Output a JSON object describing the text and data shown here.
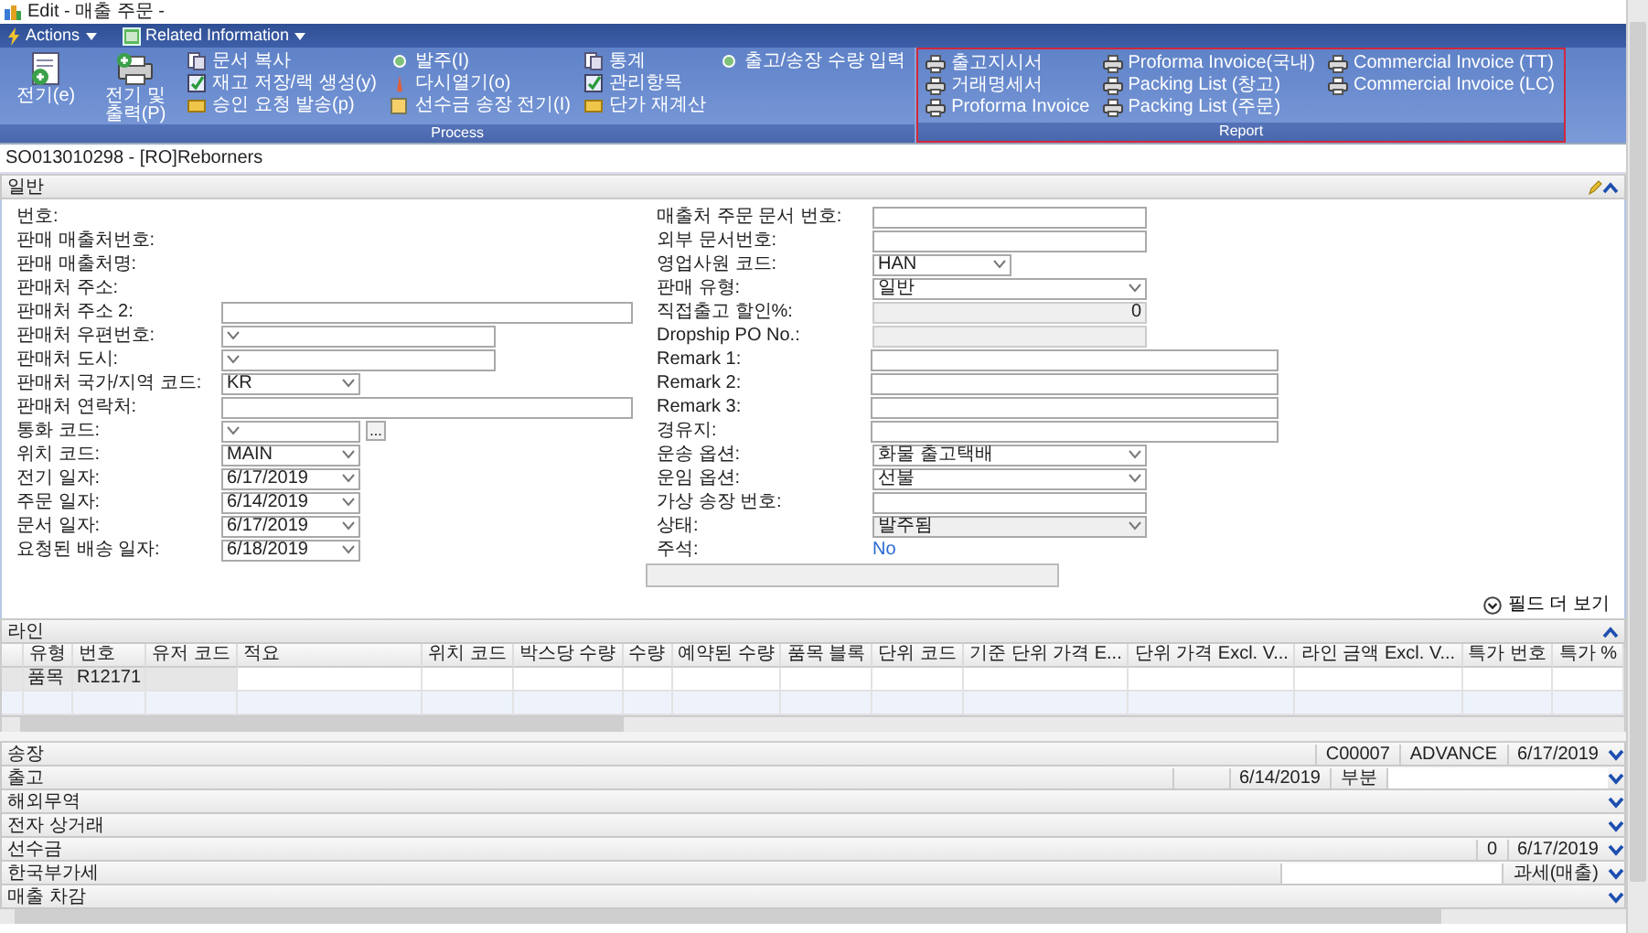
{
  "window": {
    "title": "Edit - 매출 주문 -"
  },
  "menu": [
    {
      "label": "Actions"
    },
    {
      "label": "Related Information"
    }
  ],
  "ribbon": {
    "groups": [
      {
        "label": "Process",
        "highlighted": false,
        "large_buttons": [
          {
            "label": "전기(e)"
          },
          {
            "label": "전기 및 출력(P)"
          }
        ],
        "columns": [
          [
            "문서 복사",
            "재고 저장/랙 생성(y)",
            "승인 요청 발송(p)"
          ],
          [
            "발주(I)",
            "다시열기(o)",
            "선수금 송장 전기(I)"
          ],
          [
            "통계",
            "관리항목",
            "단가 재계산"
          ],
          [
            "출고/송장 수량 입력"
          ]
        ]
      },
      {
        "label": "Report",
        "highlighted": true,
        "columns": [
          [
            "출고지시서",
            "거래명세서",
            "Proforma Invoice"
          ],
          [
            "Proforma Invoice(국내)",
            "Packing List (창고)",
            "Packing List (주문)"
          ],
          [
            "Commercial Invoice (TT)",
            "Commercial Invoice (LC)"
          ]
        ]
      }
    ]
  },
  "document_title": "SO013010298 - [RO]Reborners",
  "general": {
    "title": "일반",
    "expanded": true,
    "left_fields": [
      {
        "label": "번호:",
        "kind": "none"
      },
      {
        "label": "판매 매출처번호:",
        "kind": "none"
      },
      {
        "label": "판매 매출처명:",
        "kind": "none"
      },
      {
        "label": "판매처 주소:",
        "kind": "none"
      },
      {
        "label": "판매처 주소 2:",
        "kind": "text_wide"
      },
      {
        "label": "판매처 우편번호:",
        "kind": "select"
      },
      {
        "label": "판매처 도시:",
        "kind": "select"
      },
      {
        "label": "판매처 국가/지역 코드:",
        "kind": "select_short",
        "value": "KR"
      },
      {
        "label": "판매처 연락처:",
        "kind": "text_wide"
      },
      {
        "label": "통화 코드:",
        "kind": "lookup",
        "button": "..."
      },
      {
        "label": "위치 코드:",
        "kind": "select_short",
        "value": "MAIN"
      },
      {
        "label": "전기 일자:",
        "kind": "select_short",
        "value": "6/17/2019"
      },
      {
        "label": "주문 일자:",
        "kind": "select_short",
        "value": "6/14/2019"
      },
      {
        "label": "문서 일자:",
        "kind": "select_short",
        "value": "6/17/2019"
      },
      {
        "label": "요청된 배송 일자:",
        "kind": "select_short",
        "value": "6/18/2019"
      }
    ],
    "right_fields": [
      {
        "label": "매출처 주문 문서 번호:",
        "kind": "text"
      },
      {
        "label": "외부 문서번호:",
        "kind": "text"
      },
      {
        "label": "영업사원 코드:",
        "kind": "select_short",
        "value": "HAN"
      },
      {
        "label": "판매 유형:",
        "kind": "select",
        "value": "일반"
      },
      {
        "label": "직접출고 할인%:",
        "kind": "readonly",
        "value": "0"
      },
      {
        "label": "Dropship PO No.:",
        "kind": "readonly"
      },
      {
        "label": "Remark 1:",
        "kind": "text_wide"
      },
      {
        "label": "Remark 2:",
        "kind": "text_wide"
      },
      {
        "label": "Remark 3:",
        "kind": "text_wide"
      },
      {
        "label": "경유지:",
        "kind": "text_wide"
      },
      {
        "label": "운송 옵션:",
        "kind": "select",
        "value": "화물 출고택배"
      },
      {
        "label": "운임 옵션:",
        "kind": "select",
        "value": "선불"
      },
      {
        "label": "가상 송장 번호:",
        "kind": "text"
      },
      {
        "label": "상태:",
        "kind": "select_readonly",
        "value": "발주됨"
      },
      {
        "label": "주석:",
        "kind": "link",
        "value": "No"
      }
    ],
    "note_box": true,
    "more_fields": "필드 더 보기"
  },
  "lines": {
    "title": "라인",
    "expanded": true,
    "columns": [
      "유형",
      "번호",
      "유저 코드",
      "적요",
      "위치 코드",
      "박스당 수량",
      "수량",
      "예약된 수량",
      "품목 블록",
      "단위 코드",
      "기준 단위 가격 E...",
      "단위 가격 Excl. V...",
      "라인 금액 Excl. V...",
      "특가 번호",
      "특가 %"
    ],
    "rows": [
      {
        "cells": [
          "품목",
          "R12171"
        ],
        "selected": true
      }
    ]
  },
  "sections": [
    {
      "title": "송장",
      "values": [
        {
          "kind": "text",
          "text": "C00007"
        },
        {
          "kind": "text",
          "text": "ADVANCE"
        },
        {
          "kind": "text",
          "text": "6/17/2019"
        }
      ]
    },
    {
      "title": "출고",
      "values": [
        {
          "kind": "empty"
        },
        {
          "kind": "text",
          "text": "6/14/2019"
        },
        {
          "kind": "text",
          "text": "부분"
        },
        {
          "kind": "box"
        }
      ]
    },
    {
      "title": "해외무역"
    },
    {
      "title": "전자 상거래"
    },
    {
      "title": "선수금",
      "values": [
        {
          "kind": "text",
          "text": "0"
        },
        {
          "kind": "text",
          "text": "6/17/2019"
        }
      ]
    },
    {
      "title": "한국부가세",
      "values": [
        {
          "kind": "box"
        },
        {
          "kind": "text",
          "text": "과세(매출)"
        }
      ]
    },
    {
      "title": "매출 차감"
    }
  ]
}
